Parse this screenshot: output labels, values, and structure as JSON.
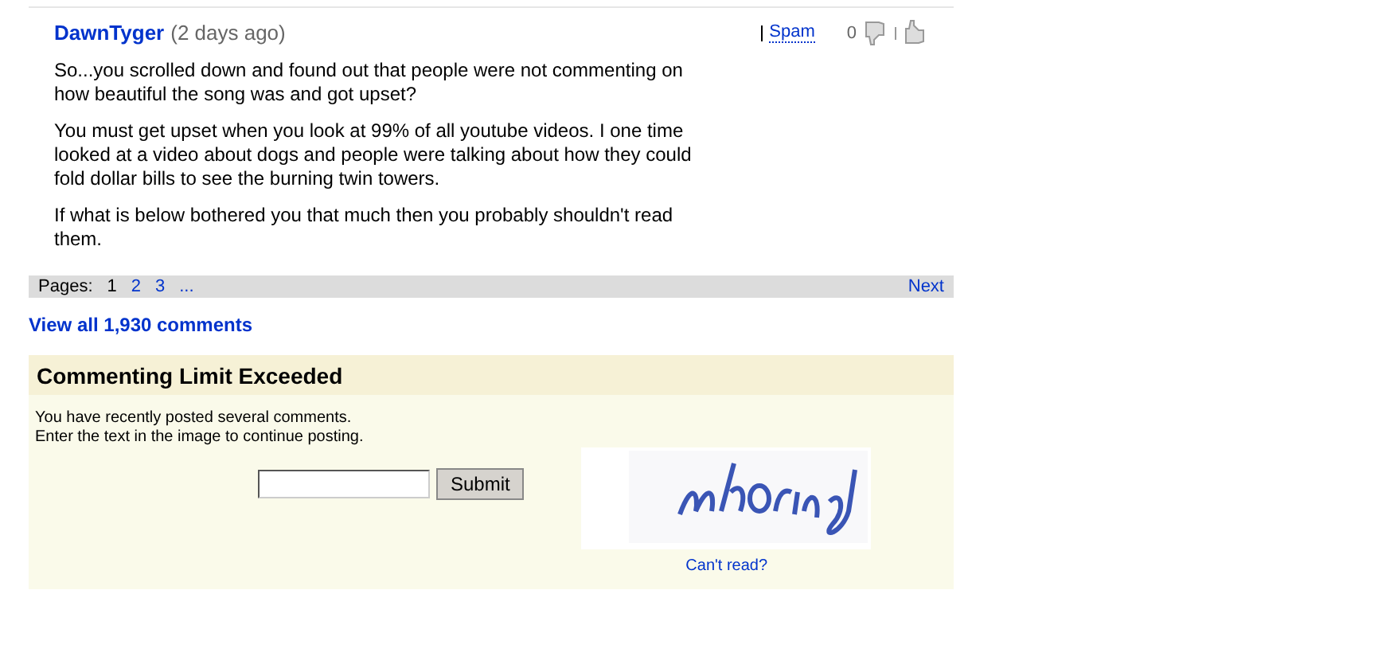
{
  "comment": {
    "author": "DawnTyger",
    "age": "(2 days ago)",
    "spam": "Spam",
    "votes": "0",
    "paragraphs": [
      "So...you scrolled down and found out that people were not commenting on how beautiful the song was and got upset?",
      "You must get upset when you look at 99% of all youtube videos. I one time looked at a video about dogs and people were talking about how they could fold dollar bills to see the burning twin towers.",
      "If what is below bothered you that much then you probably shouldn't read them."
    ]
  },
  "pager": {
    "label": "Pages:",
    "pages": [
      {
        "label": "1",
        "selected": true
      },
      {
        "label": "2",
        "selected": false
      },
      {
        "label": "3",
        "selected": false
      }
    ],
    "ellipsis": "...",
    "next": "Next"
  },
  "view_all": "View all 1,930 comments",
  "limit": {
    "title": "Commenting Limit Exceeded",
    "message": [
      "You have recently posted several comments.",
      "Enter the text in the image to continue posting."
    ],
    "submit": "Submit",
    "captcha": {
      "kind": "picture"
    },
    "cant_read": "Can't read?"
  }
}
